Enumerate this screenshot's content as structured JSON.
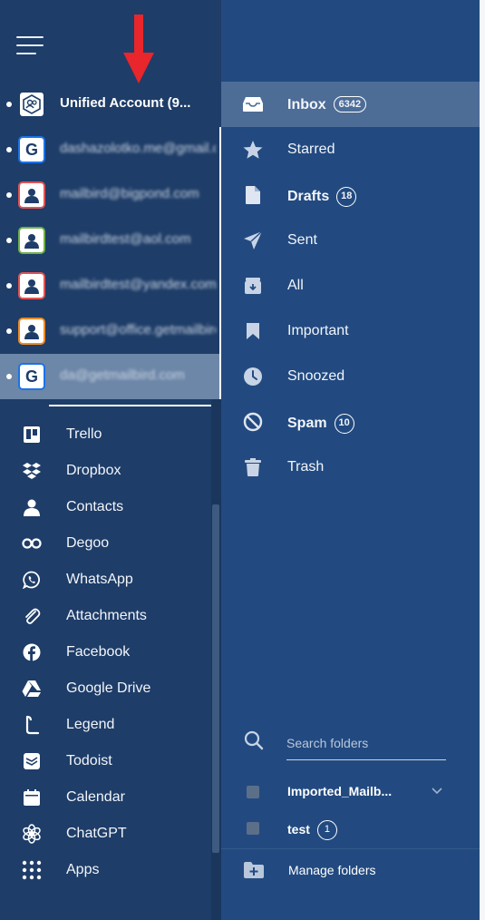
{
  "accounts": [
    {
      "name": "Unified Account (9...",
      "icon": "unified-account-icon",
      "border": "#1e3d68",
      "blurred": false
    },
    {
      "name": "dashazolotko.me@gmail.com",
      "icon": "google-icon",
      "border": "#1a73e8",
      "blurred": true
    },
    {
      "name": "mailbird@bigpond.com",
      "icon": "person-icon",
      "border": "#e05454",
      "blurred": true
    },
    {
      "name": "mailbirdtest@aol.com",
      "icon": "person-icon",
      "border": "#6fb04c",
      "blurred": true
    },
    {
      "name": "mailbirdtest@yandex.com",
      "icon": "person-icon",
      "border": "#e05454",
      "blurred": true
    },
    {
      "name": "support@office.getmailbird.com",
      "icon": "person-icon",
      "border": "#f08a24",
      "blurred": true
    },
    {
      "name": "da@getmailbird.com",
      "icon": "google-icon",
      "border": "#1a73e8",
      "blurred": true
    }
  ],
  "apps": [
    {
      "label": "Trello",
      "icon": "trello-icon"
    },
    {
      "label": "Dropbox",
      "icon": "dropbox-icon"
    },
    {
      "label": "Contacts",
      "icon": "contacts-icon"
    },
    {
      "label": "Degoo",
      "icon": "degoo-icon"
    },
    {
      "label": "WhatsApp",
      "icon": "whatsapp-icon"
    },
    {
      "label": "Attachments",
      "icon": "paperclip-icon"
    },
    {
      "label": "Facebook",
      "icon": "facebook-icon"
    },
    {
      "label": "Google Drive",
      "icon": "google-drive-icon"
    },
    {
      "label": "Legend",
      "icon": "legend-icon"
    },
    {
      "label": "Todoist",
      "icon": "todoist-icon"
    },
    {
      "label": "Calendar",
      "icon": "calendar-icon"
    },
    {
      "label": "ChatGPT",
      "icon": "chatgpt-icon"
    },
    {
      "label": "Apps",
      "icon": "apps-grid-icon"
    }
  ],
  "folders": [
    {
      "label": "Inbox",
      "count": "6342",
      "bold": true,
      "icon": "inbox-icon",
      "active": true
    },
    {
      "label": "Starred",
      "count": "",
      "bold": false,
      "icon": "star-icon",
      "active": false
    },
    {
      "label": "Drafts",
      "count": "18",
      "bold": true,
      "icon": "draft-icon",
      "active": false
    },
    {
      "label": "Sent",
      "count": "",
      "bold": false,
      "icon": "sent-icon",
      "active": false
    },
    {
      "label": "All",
      "count": "",
      "bold": false,
      "icon": "archive-icon",
      "active": false
    },
    {
      "label": "Important",
      "count": "",
      "bold": false,
      "icon": "bookmark-icon",
      "active": false
    },
    {
      "label": "Snoozed",
      "count": "",
      "bold": false,
      "icon": "clock-icon",
      "active": false
    },
    {
      "label": "Spam",
      "count": "10",
      "bold": true,
      "icon": "spam-icon",
      "active": false
    },
    {
      "label": "Trash",
      "count": "",
      "bold": false,
      "icon": "trash-icon",
      "active": false
    }
  ],
  "search": {
    "placeholder": "Search folders"
  },
  "subfolders": [
    {
      "label": "Imported_Mailb...",
      "count": ""
    },
    {
      "label": "test",
      "count": "1"
    }
  ],
  "manage_label": "Manage folders",
  "colors": {
    "sidebar": "#1e3d68",
    "panel": "#224a80",
    "active": "#4d6d97",
    "arrow": "#e8262b"
  }
}
